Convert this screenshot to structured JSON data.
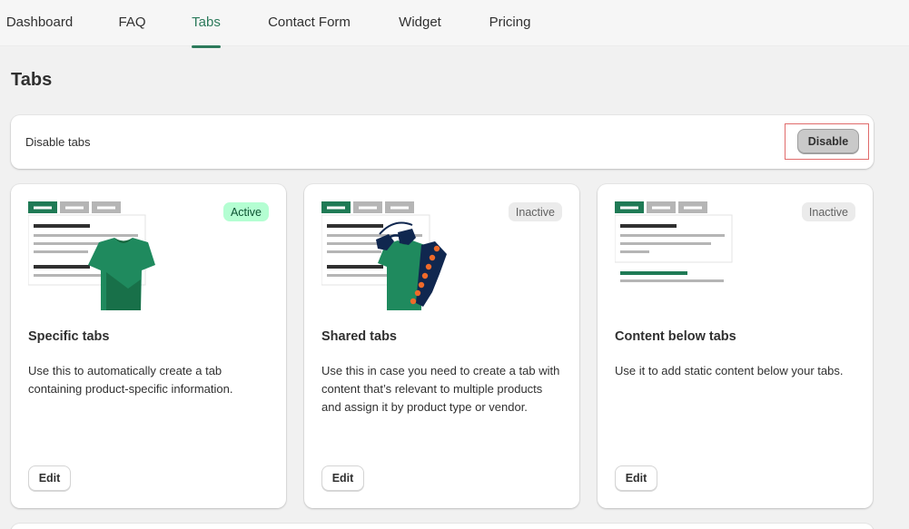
{
  "nav": {
    "tabs": [
      {
        "label": "Dashboard"
      },
      {
        "label": "FAQ"
      },
      {
        "label": "Tabs"
      },
      {
        "label": "Contact Form"
      },
      {
        "label": "Widget"
      },
      {
        "label": "Pricing"
      }
    ],
    "active_tab": "Tabs"
  },
  "page": {
    "title": "Tabs"
  },
  "disable_section": {
    "label": "Disable tabs",
    "button_label": "Disable"
  },
  "cards": [
    {
      "title": "Specific tabs",
      "status": "Active",
      "description": "Use this to automatically create a tab containing product-specific information.",
      "edit_label": "Edit",
      "illustration": "tshirt-tabs-illustration"
    },
    {
      "title": "Shared tabs",
      "status": "Inactive",
      "description": "Use this in case you need to create a tab with content that’s relevant to multiple products and assign it by product type or vendor.",
      "edit_label": "Edit",
      "illustration": "shared-products-illustration"
    },
    {
      "title": "Content below tabs",
      "status": "Inactive",
      "description": "Use it to add static content below your tabs.",
      "edit_label": "Edit",
      "illustration": "content-below-tabs-illustration"
    }
  ],
  "colors": {
    "accent_green": "#2c7a5b",
    "active_badge_bg": "#b4fed2",
    "inactive_badge_bg": "#ebebeb",
    "highlight_red": "#e06b6b",
    "shirt_green": "#1f8a5e"
  }
}
